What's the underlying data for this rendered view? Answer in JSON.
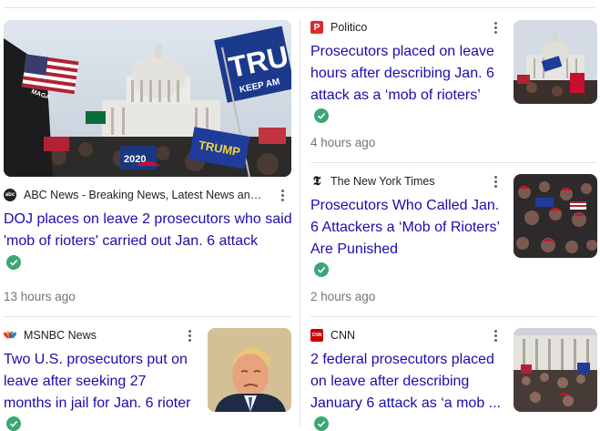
{
  "articles": [
    {
      "source": "ABC News - Breaking News, Latest News and Vid...",
      "logo_text": "abc",
      "headline_lines": [
        "DOJ places on leave 2 prosecutors who said",
        "'mob of rioters' carried out Jan. 6 attack"
      ],
      "time": "13 hours ago",
      "thumbnail": "capitol-rally-flags-image",
      "thumbnail_text": [
        "TRU",
        "KEEP AM",
        "TRUMP",
        "2020",
        "MAGA"
      ]
    },
    {
      "source": "Politico",
      "logo_text": "P",
      "headline_lines": [
        "Prosecutors placed on leave",
        "hours after describing Jan. 6",
        "attack as a ‘mob of rioters’"
      ],
      "time": "4 hours ago",
      "thumbnail": "capitol-crowd-image"
    },
    {
      "source": "The New York Times",
      "logo_text": "𝕿",
      "headline_lines": [
        "Prosecutors Who Called Jan.",
        "6 Attackers a ‘Mob of Rioters’",
        "Are Punished"
      ],
      "time": "2 hours ago",
      "thumbnail": "rioters-crowd-image"
    },
    {
      "source": "MSNBC News",
      "logo_text": "peacock",
      "headline_lines": [
        "Two U.S. prosecutors put on",
        "leave after seeking 27",
        "months in jail for Jan. 6 rioter"
      ],
      "thumbnail": "trump-portrait-image"
    },
    {
      "source": "CNN",
      "logo_text": "CNN",
      "headline_lines": [
        "2 federal prosecutors placed",
        "on leave after describing",
        "January 6 attack as ‘a mob ..."
      ],
      "thumbnail": "capitol-steps-crowd-image"
    }
  ],
  "colors": {
    "headline": "#1a0dab",
    "verified": "#3ba776",
    "politico": "#dc2b2b",
    "cnn": "#cc0000"
  }
}
